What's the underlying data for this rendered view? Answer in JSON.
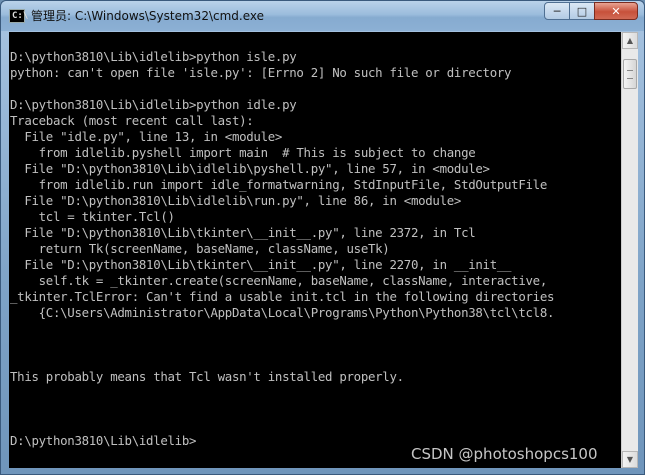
{
  "window": {
    "title": "管理员: C:\\Windows\\System32\\cmd.exe",
    "controls": {
      "minimize": "─",
      "maximize": "□",
      "close": "✕"
    }
  },
  "console": {
    "lines": [
      "D:\\python3810\\Lib\\idlelib>python isle.py",
      "python: can't open file 'isle.py': [Errno 2] No such file or directory",
      "",
      "D:\\python3810\\Lib\\idlelib>python idle.py",
      "Traceback (most recent call last):",
      "  File \"idle.py\", line 13, in <module>",
      "    from idlelib.pyshell import main  # This is subject to change",
      "  File \"D:\\python3810\\Lib\\idlelib\\pyshell.py\", line 57, in <module>",
      "    from idlelib.run import idle_formatwarning, StdInputFile, StdOutputFile",
      "  File \"D:\\python3810\\Lib\\idlelib\\run.py\", line 86, in <module>",
      "    tcl = tkinter.Tcl()",
      "  File \"D:\\python3810\\Lib\\tkinter\\__init__.py\", line 2372, in Tcl",
      "    return Tk(screenName, baseName, className, useTk)",
      "  File \"D:\\python3810\\Lib\\tkinter\\__init__.py\", line 2270, in __init__",
      "    self.tk = _tkinter.create(screenName, baseName, className, interactive,",
      "_tkinter.TclError: Can't find a usable init.tcl in the following directories",
      "    {C:\\Users\\Administrator\\AppData\\Local\\Programs\\Python\\Python38\\tcl\\tcl8.",
      "",
      "",
      "",
      "This probably means that Tcl wasn't installed properly.",
      "",
      "",
      "",
      "D:\\python3810\\Lib\\idlelib>"
    ]
  },
  "watermark": "CSDN @photoshopcs100"
}
